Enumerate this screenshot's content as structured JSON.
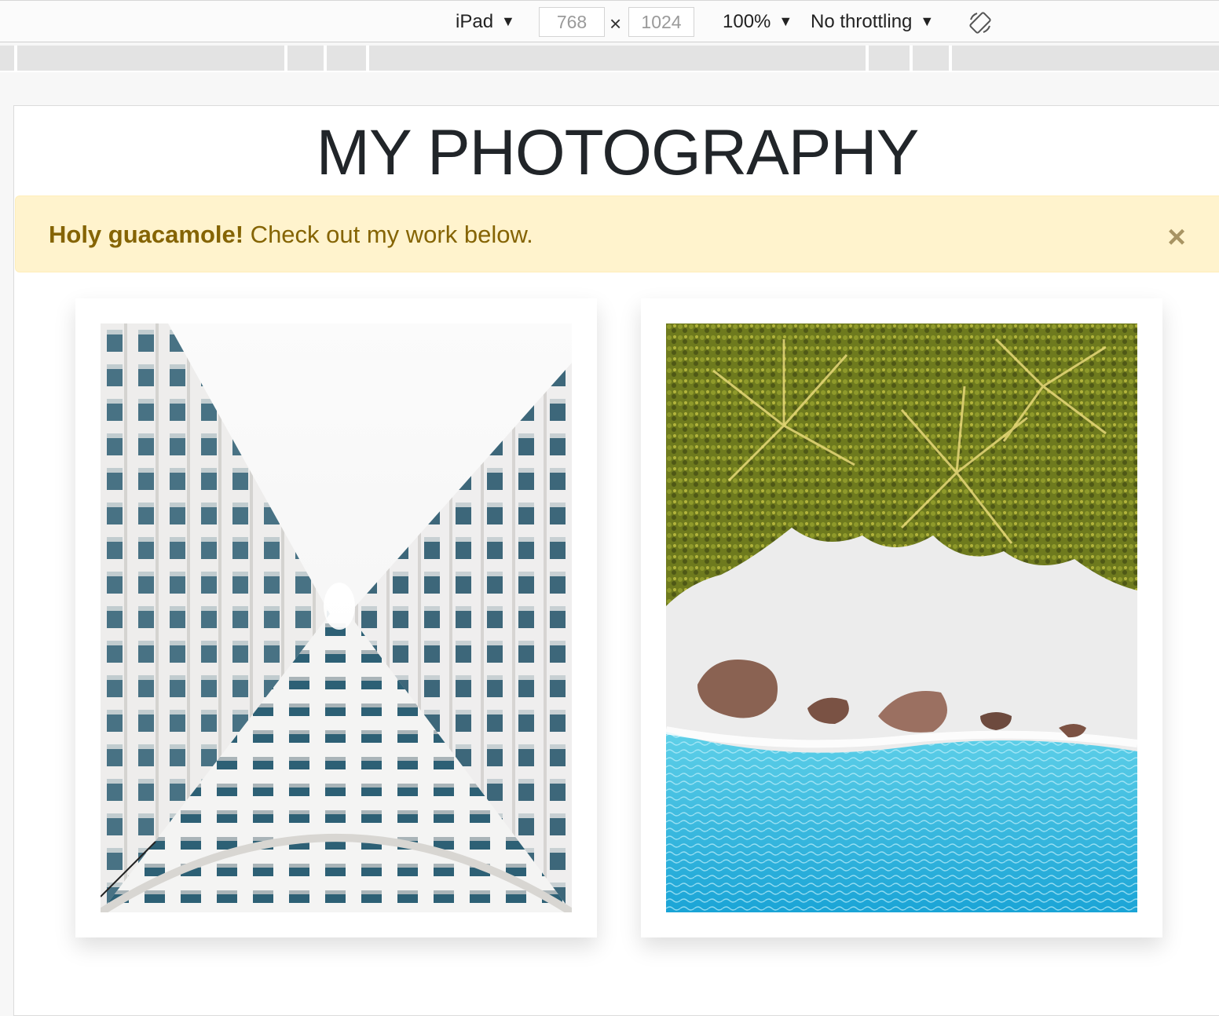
{
  "devtools": {
    "device": "iPad",
    "width_value": "768",
    "height_value": "1024",
    "times": "×",
    "zoom": "100%",
    "throttling": "No throttling",
    "rotate_icon": "rotate-icon"
  },
  "page": {
    "title": "MY PHOTOGRAPHY",
    "alert": {
      "strong": "Holy guacamole!",
      "text": " Check out my work below.",
      "close": "×",
      "bg_color": "#fff3cd",
      "text_color": "#856404"
    },
    "photos": [
      {
        "subject": "architecture-looking-up"
      },
      {
        "subject": "aerial-beach-palms"
      }
    ]
  }
}
